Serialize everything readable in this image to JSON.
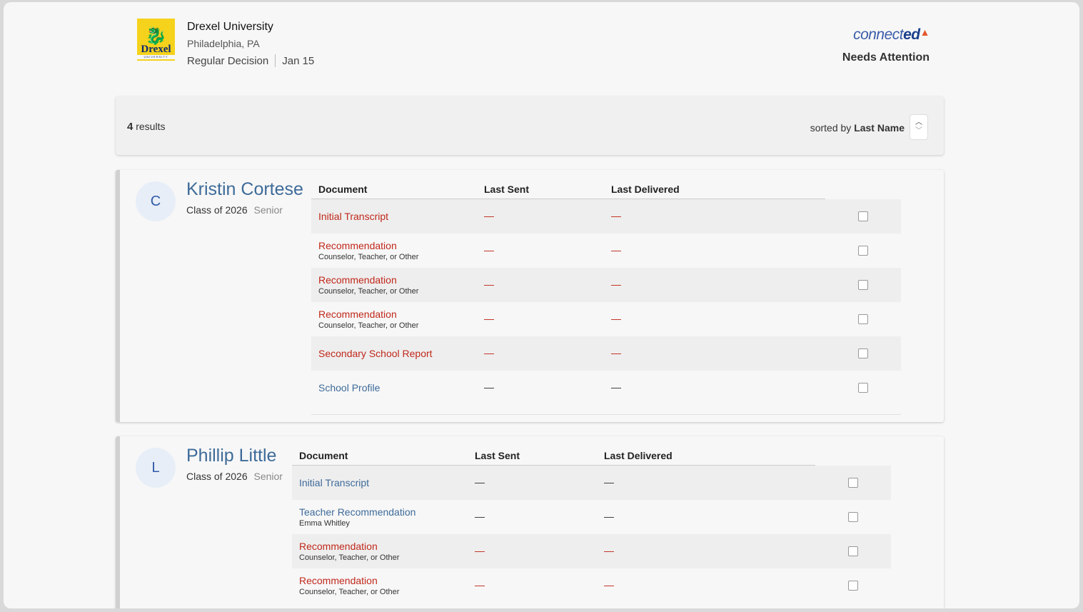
{
  "university": {
    "name": "Drexel University",
    "location": "Philadelphia, PA",
    "decision_type": "Regular Decision",
    "deadline": "Jan 15",
    "logo_word": "Drexel",
    "logo_sub": "UNIVERSITY"
  },
  "brand": {
    "name_prefix": "connect",
    "name_suffix": "ed",
    "status": "Needs Attention"
  },
  "results": {
    "count": "4",
    "count_label": "results",
    "sorted_prefix": "sorted by",
    "sorted_field": "Last Name"
  },
  "table_headers": {
    "document": "Document",
    "last_sent": "Last Sent",
    "last_delivered": "Last Delivered"
  },
  "students": [
    {
      "initial": "C",
      "name": "Kristin Cortese",
      "class": "Class of 2026",
      "level": "Senior",
      "documents": [
        {
          "title": "Initial Transcript",
          "subtitle": "",
          "status": "red",
          "last_sent": "—",
          "last_delivered": "—"
        },
        {
          "title": "Recommendation",
          "subtitle": "Counselor, Teacher, or Other",
          "status": "red",
          "last_sent": "—",
          "last_delivered": "—"
        },
        {
          "title": "Recommendation",
          "subtitle": "Counselor, Teacher, or Other",
          "status": "red",
          "last_sent": "—",
          "last_delivered": "—"
        },
        {
          "title": "Recommendation",
          "subtitle": "Counselor, Teacher, or Other",
          "status": "red",
          "last_sent": "—",
          "last_delivered": "—"
        },
        {
          "title": "Secondary School Report",
          "subtitle": "",
          "status": "red",
          "last_sent": "—",
          "last_delivered": "—"
        },
        {
          "title": "School Profile",
          "subtitle": "",
          "status": "blue",
          "last_sent": "—",
          "last_delivered": "—"
        }
      ]
    },
    {
      "initial": "L",
      "name": "Phillip Little",
      "class": "Class of 2026",
      "level": "Senior",
      "documents": [
        {
          "title": "Initial Transcript",
          "subtitle": "",
          "status": "blue",
          "last_sent": "—",
          "last_delivered": "—"
        },
        {
          "title": "Teacher Recommendation",
          "subtitle": "Emma Whitley",
          "status": "blue",
          "last_sent": "—",
          "last_delivered": "—"
        },
        {
          "title": "Recommendation",
          "subtitle": "Counselor, Teacher, or Other",
          "status": "red",
          "last_sent": "—",
          "last_delivered": "—"
        },
        {
          "title": "Recommendation",
          "subtitle": "Counselor, Teacher, or Other",
          "status": "red",
          "last_sent": "—",
          "last_delivered": "—"
        }
      ]
    }
  ],
  "colors": {
    "alert_red": "#c0281b",
    "link_blue": "#3e6b99",
    "brand_blue": "#3a5ca8"
  }
}
